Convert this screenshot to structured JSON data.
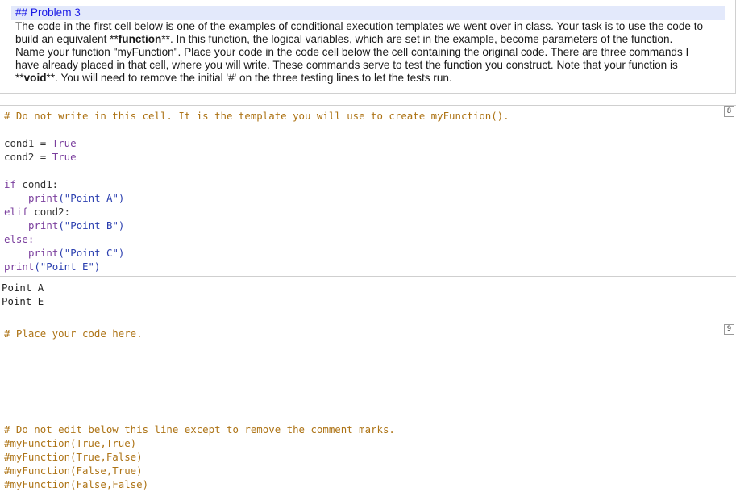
{
  "markdown_cell": {
    "heading": "## Problem 3",
    "lines": [
      "The code in the first cell below is one of the examples of conditional execution templates we went over in class. Your task is to use the code to",
      "build an equivalent **function**. In this function, the logical variables, which are set in the example, become parameters of the function.",
      "Name your function \"myFunction\". Place your code in the code cell below the cell containing the original code. There are three commands I",
      "have already placed in that cell, where you will write. These commands serve to test the function you construct. Note that your function is",
      "**void**.  You will need to remove the initial '#' on the three testing lines to let the tests run."
    ]
  },
  "code_cell_1": {
    "exec_count": "8",
    "comment": "# Do not write in this cell. It is the template you will use to create myFunction().",
    "cond1_name": "cond1",
    "cond1_value": "True",
    "cond2_name": "cond2",
    "cond2_value": "True",
    "if_kw": "if",
    "if_cond": " cond1:",
    "print_a_fn": "print",
    "print_a_arg": "(\"Point A\")",
    "elif_kw": "elif",
    "elif_cond": " cond2:",
    "print_b_fn": "print",
    "print_b_arg": "(\"Point B\")",
    "else_kw": "else:",
    "print_c_fn": "print",
    "print_c_arg": "(\"Point C\")",
    "print_e_fn": "print",
    "print_e_arg": "(\"Point E\")"
  },
  "output_1": {
    "lines": [
      "Point A",
      "Point E"
    ]
  },
  "code_cell_2": {
    "exec_count": "9",
    "comment": "# Place your code here.",
    "lines": [
      "# Do not edit below this line except to remove the comment marks.",
      "#myFunction(True,True)",
      "#myFunction(True,False)",
      "#myFunction(False,True)",
      "#myFunction(False,False)"
    ]
  }
}
